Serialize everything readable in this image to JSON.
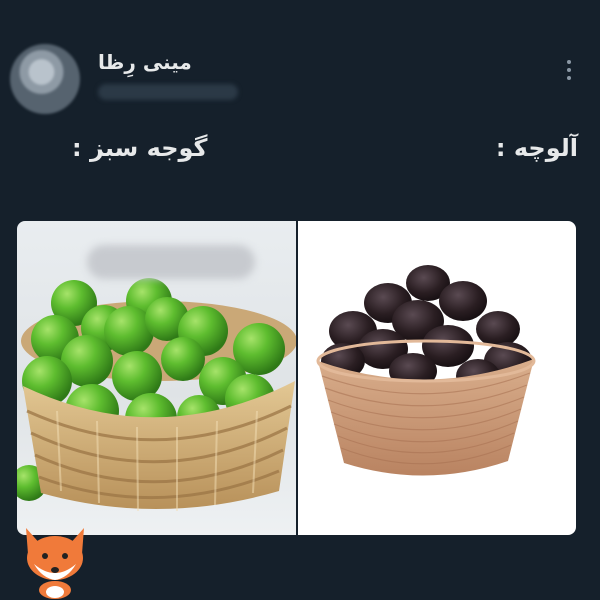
{
  "post": {
    "author_name": "مینی رِظا",
    "more_icon": "more-vertical-icon",
    "label_right": "آلوچه :",
    "label_left": "گوجه سبز :"
  },
  "images": {
    "left_subject": "green plums in woven basket",
    "right_subject": "dark dried plums in wooden bowl"
  },
  "colors": {
    "background": "#15202b",
    "text": "#e7e9ea",
    "green_plum": "#5ebd2f",
    "dried_plum": "#2a1e22",
    "wood_bowl": "#c89a79"
  }
}
